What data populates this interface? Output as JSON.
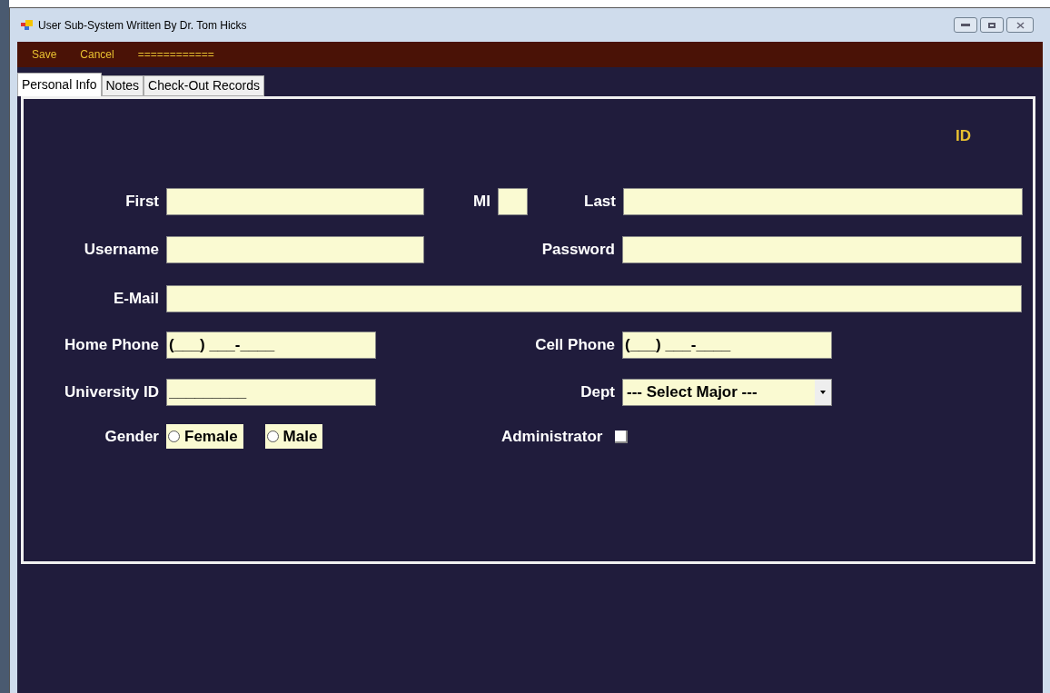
{
  "window": {
    "title": "User Sub-System Written By Dr. Tom Hicks"
  },
  "menu": [
    "Save",
    "Cancel",
    "============"
  ],
  "tabs": [
    {
      "label": "Personal Info",
      "selected": true
    },
    {
      "label": "Notes",
      "selected": false
    },
    {
      "label": "Check-Out Records",
      "selected": false
    }
  ],
  "id_label": "ID",
  "form": {
    "first": {
      "label": "First"
    },
    "mi": {
      "label": "MI"
    },
    "last": {
      "label": "Last"
    },
    "username": {
      "label": "Username"
    },
    "password": {
      "label": "Password"
    },
    "email": {
      "label": "E-Mail"
    },
    "home_phone": {
      "label": "Home Phone",
      "value": "(___) ___-____"
    },
    "cell_phone": {
      "label": "Cell Phone",
      "value": "(___) ___-____"
    },
    "university_id": {
      "label": "University ID",
      "value": "_________"
    },
    "dept": {
      "label": "Dept",
      "value": "--- Select Major ---"
    },
    "gender": {
      "label": "Gender",
      "options": [
        {
          "label": "Female",
          "selected": false
        },
        {
          "label": "Male",
          "selected": false
        }
      ]
    },
    "administrator": {
      "label": "Administrator",
      "checked": false
    }
  }
}
